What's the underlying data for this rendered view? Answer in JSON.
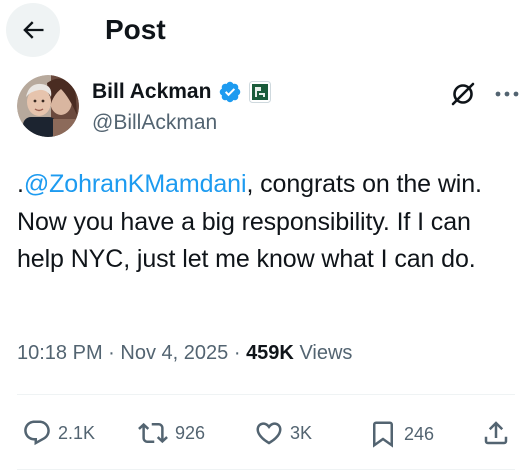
{
  "header": {
    "title": "Post",
    "back_icon": "arrow-left-icon"
  },
  "author": {
    "name": "Bill Ackman",
    "handle": "@BillAckman",
    "verified_icon": "verified-badge-icon",
    "affiliation_icon": "pershing-square-affiliate-badge",
    "colors": {
      "verified": "#1d9bf0",
      "affiliation": "#1a5c3a"
    }
  },
  "post": {
    "mention": "@ZohranKMamdani",
    "prefix": ".",
    "text_after_mention": ", congrats on the win. Now you have a big responsibility. If I can help NYC, just let me know what I can do."
  },
  "meta": {
    "time": "10:18 PM",
    "separator": "·",
    "date": "Nov 4, 2025",
    "views_count": "459K",
    "views_label": "Views"
  },
  "actions": {
    "replies": "2.1K",
    "reposts": "926",
    "likes": "3K",
    "bookmarks": "246"
  },
  "colors": {
    "text_primary": "#0f1419",
    "text_secondary": "#536471",
    "link": "#1d9bf0",
    "back_button_bg": "#eff3f4"
  }
}
